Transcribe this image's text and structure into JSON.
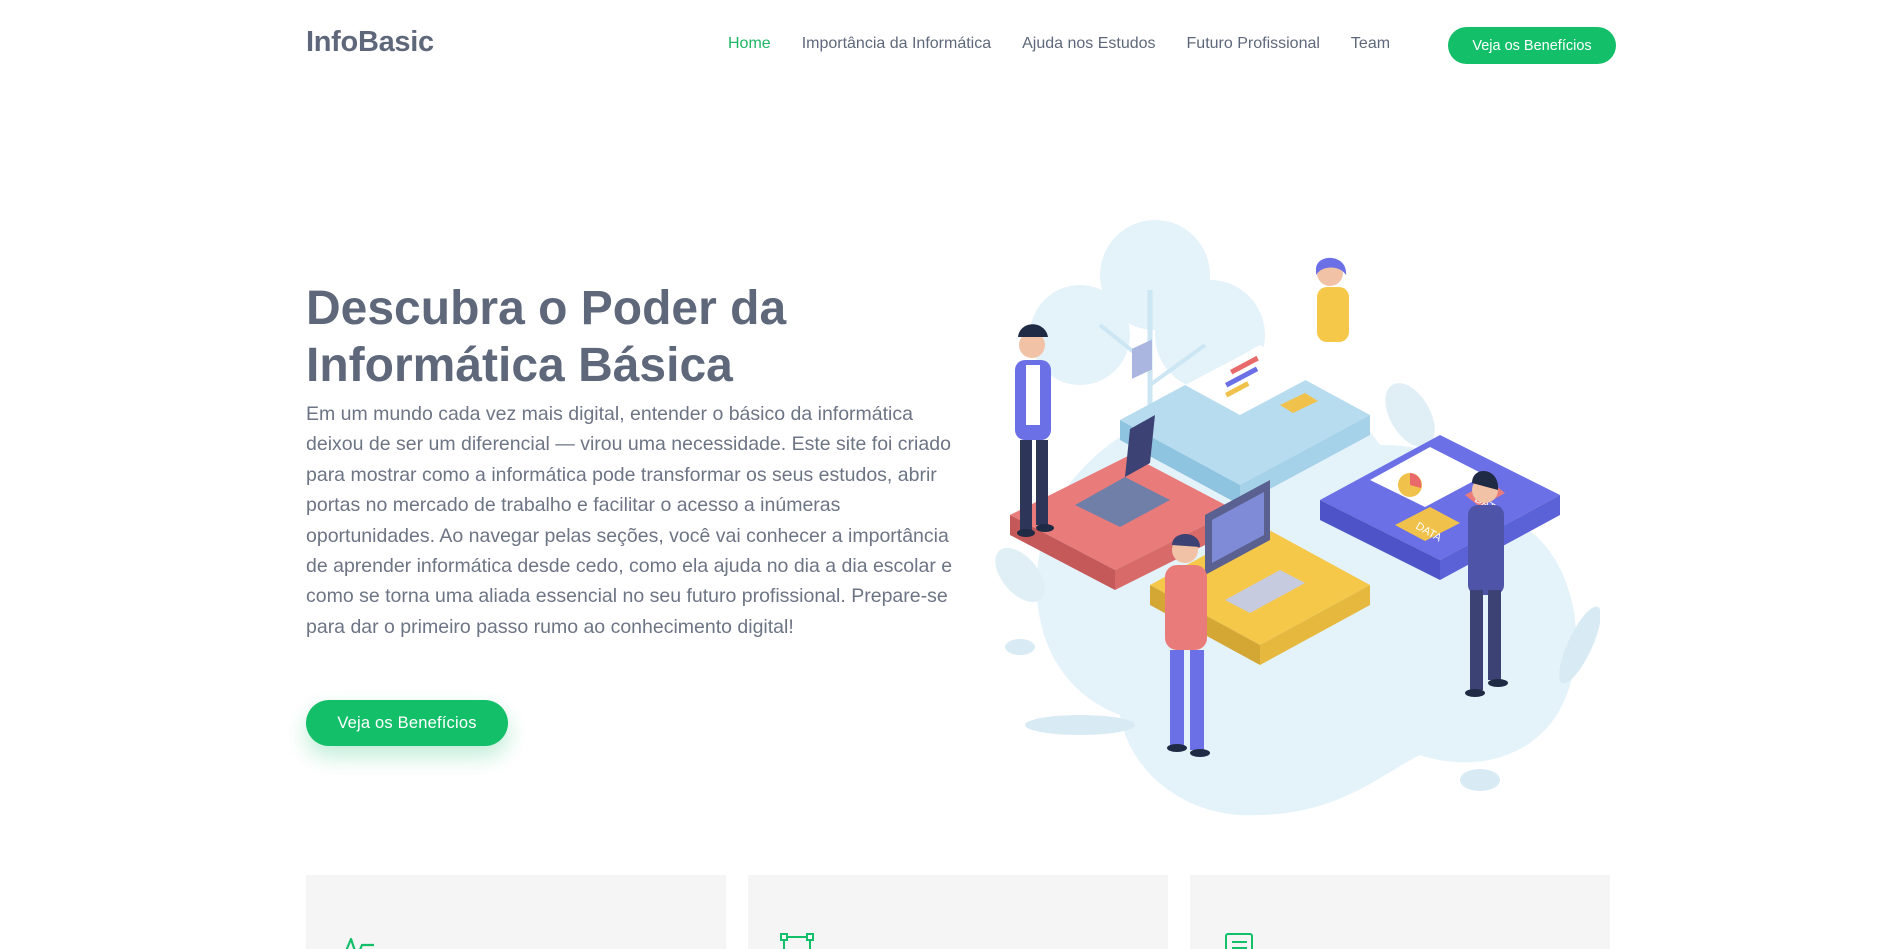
{
  "brand": {
    "logo": "InfoBasic",
    "accent": "#14bf6a",
    "text_color": "#5f687b"
  },
  "nav": {
    "items": [
      {
        "label": "Home",
        "active": true
      },
      {
        "label": "Importância da Informática",
        "active": false
      },
      {
        "label": "Ajuda nos Estudos",
        "active": false
      },
      {
        "label": "Futuro Profissional",
        "active": false
      },
      {
        "label": "Team",
        "active": false
      }
    ],
    "cta_label": "Veja os Benefícios"
  },
  "hero": {
    "title": "Descubra o Poder da Informática Básica",
    "text": "Em um mundo cada vez mais digital, entender o básico da informática deixou de ser um diferencial — virou uma necessidade. Este site foi criado para mostrar como a informática pode transformar os seus estudos, abrir portas no mercado de trabalho e facilitar o acesso a inúmeras oportunidades. Ao navegar pelas seções, você vai conhecer a importância de aprender informática desde cedo, como ela ajuda no dia a dia escolar e como se torna uma aliada essencial no seu futuro profissional. Prepare-se para dar o primeiro passo rumo ao conhecimento digital!",
    "cta_label": "Veja os Benefícios",
    "illustration": "team-assembling-puzzle-illustration",
    "illustration_texts": [
      "DATA",
      "DATA"
    ]
  },
  "feature_cards": [
    {
      "icon": "activity-pulse-icon"
    },
    {
      "icon": "vector-square-icon"
    },
    {
      "icon": "document-list-icon"
    }
  ]
}
